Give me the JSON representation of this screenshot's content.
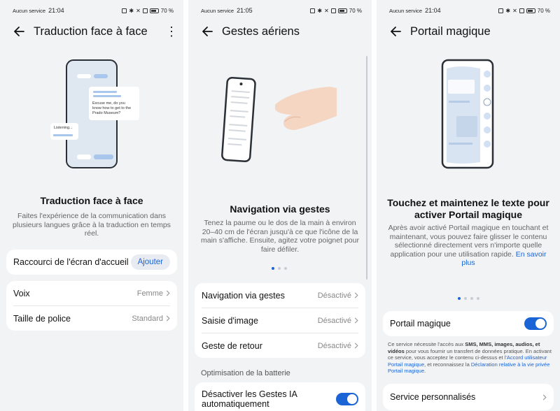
{
  "status_bar": {
    "carrier": "Aucun service",
    "battery": "70 %"
  },
  "panel1": {
    "time": "21:04",
    "title": "Traduction face à face",
    "bubble_text": "Excuse me, do you know how to get to the Prado Museum?",
    "listening_text": "Listening...",
    "content_title": "Traduction face à face",
    "description": "Faites l'expérience de la communication dans plusieurs langues grâce à la traduction en temps réel.",
    "shortcut_label": "Raccourci de l'écran d'accueil",
    "add_label": "Ajouter",
    "voice_label": "Voix",
    "voice_value": "Femme",
    "font_label": "Taille de police",
    "font_value": "Standard"
  },
  "panel2": {
    "time": "21:05",
    "title": "Gestes aériens",
    "content_title": "Navigation via gestes",
    "description": "Tenez la paume ou le dos de la main à environ 20–40 cm de l'écran jusqu'à ce que l'icône de la main s'affiche. Ensuite, agitez votre poignet pour faire défiler.",
    "rows": [
      {
        "label": "Navigation via gestes",
        "value": "Désactivé"
      },
      {
        "label": "Saisie d'image",
        "value": "Désactivé"
      },
      {
        "label": "Geste de retour",
        "value": "Désactivé"
      }
    ],
    "section_title": "Optimisation de la batterie",
    "toggle_label": "Désactiver les Gestes IA automatiquement",
    "toggle_on": true
  },
  "panel3": {
    "time": "21:04",
    "title": "Portail magique",
    "content_title": "Touchez et maintenez le texte pour activer Portail magique",
    "description": "Après avoir activé Portail magique en touchant et maintenant, vous pouvez faire glisser le contenu sélectionné directement vers n'importe quelle application pour une utilisation rapide.",
    "learn_more": "En savoir plus",
    "toggle_label": "Portail magique",
    "toggle_on": true,
    "note_part1": "Ce service nécessite l'accès aux",
    "note_bold": "SMS, MMS, images, audios, et vidéos",
    "note_part2": "pour vous fournir un transfert de données pratique. En activant ce service, vous acceptez le contenu ci-dessus et",
    "note_link1": "l'Accord utilisateur Portail magique",
    "note_part3": ", et reconnaissez la",
    "note_link2": "Déclaration relative à la vie privée Portail magique",
    "note_end": ".",
    "service_label": "Service personnalisés"
  },
  "colors": {
    "accent": "#1a64d6",
    "background": "#f1f3f5"
  },
  "icons": [
    "back-arrow-icon",
    "more-vert-icon",
    "chevron-right-icon",
    "nfc-icon",
    "bluetooth-icon",
    "silent-icon",
    "vibrate-icon",
    "battery-icon"
  ]
}
